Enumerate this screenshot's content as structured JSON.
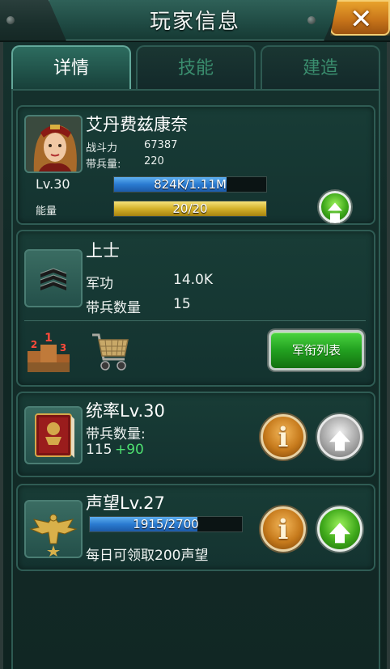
{
  "header": {
    "title": "玩家信息",
    "close_icon": "close-icon"
  },
  "tabs": [
    {
      "label": "详情",
      "active": true
    },
    {
      "label": "技能",
      "active": false
    },
    {
      "label": "建造",
      "active": false
    }
  ],
  "player": {
    "name": "艾丹费兹康奈",
    "power_label": "战斗力",
    "power_value": "67387",
    "troops_label": "带兵量:",
    "troops_value": "220",
    "level": "Lv.30",
    "exp_text": "824K/1.11M",
    "exp_fraction": 0.74,
    "energy_label": "能量",
    "energy_text": "20/20",
    "energy_fraction": 1.0
  },
  "rank": {
    "title": "上士",
    "merit_label": "军功",
    "merit_value": "14.0K",
    "troops_label": "带兵数量",
    "troops_value": "15",
    "list_button": "军衔列表"
  },
  "command": {
    "title": "统率Lv.30",
    "troops_label": "带兵数量:",
    "troops_value": "115",
    "troops_bonus": "+90"
  },
  "prestige": {
    "title": "声望Lv.27",
    "bar_text": "1915/2700",
    "bar_fraction": 0.709,
    "daily_text": "每日可领取200声望"
  },
  "colors": {
    "accent_green": "#3ea81a",
    "bar_blue": "#2a7ad0",
    "bar_gold": "#d4b22a",
    "bonus_green": "#4ee070"
  }
}
